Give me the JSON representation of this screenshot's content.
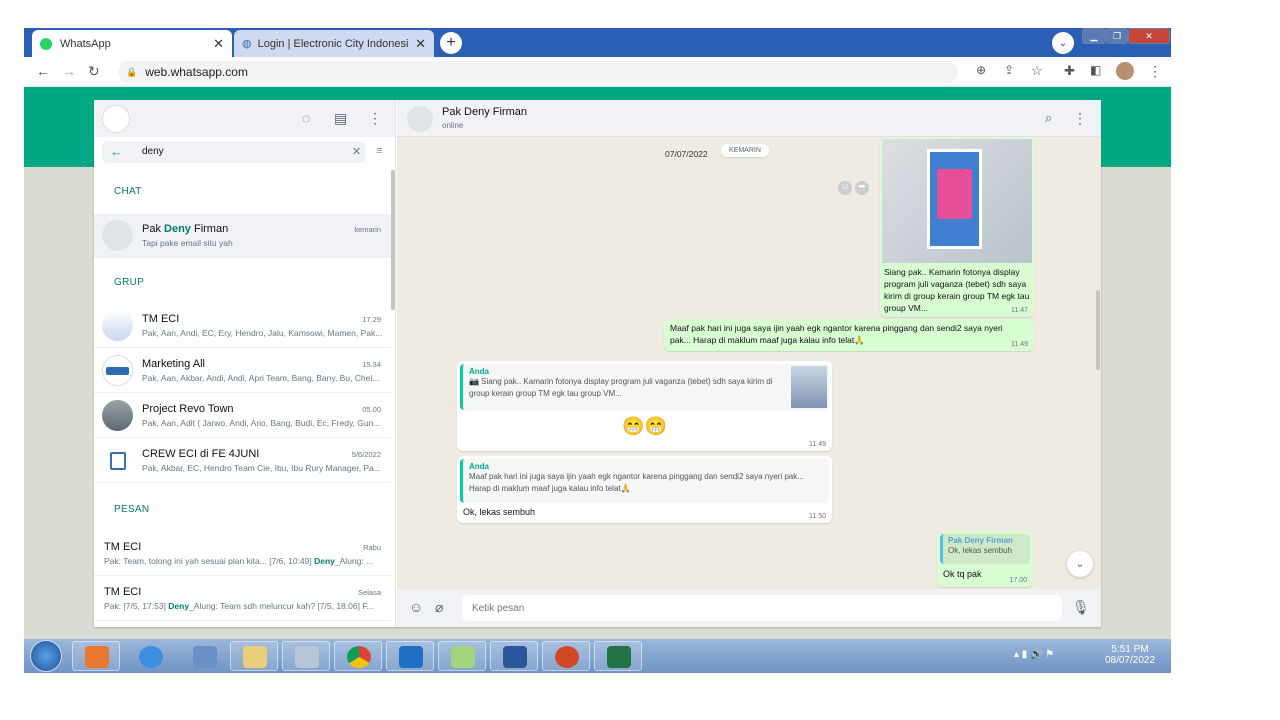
{
  "browser": {
    "tabs": [
      {
        "title": "WhatsApp",
        "active": true
      },
      {
        "title": "Login | Electronic City Indonesia",
        "active": false
      }
    ],
    "url": "web.whatsapp.com"
  },
  "sidebar": {
    "search_value": "deny",
    "sections": {
      "chat": "CHAT",
      "group": "GRUP",
      "messages": "PESAN"
    },
    "chats": [
      {
        "name_pre": "Pak ",
        "name_hl": "Deny",
        "name_post": " Firman",
        "time": "kemarin",
        "message": "Tapi pake email situ yah"
      }
    ],
    "groups": [
      {
        "name": "TM ECI",
        "time": "17.29",
        "message": "Pak, Aan, Andi, EC, Ery, Hendro, Jalu, Kamsowi, Mamen, Pak..."
      },
      {
        "name": "Marketing All",
        "time": "15.34",
        "message": "Pak, Aan, Akbar, Andi, Andi, Apri Team, Bang, Bany, Bu, Chel..."
      },
      {
        "name": "Project Revo Town",
        "time": "05.00",
        "message": "Pak, Aan, Adit ( Jarwo, Andi, Ario, Bang, Budi, Ec, Fredy, Gun..."
      },
      {
        "name": "CREW ECI di FE 4JUNI",
        "time": "5/6/2022",
        "message": "Pak, Akbar, EC, Hendro Team Cie, Ibu, Ibu Rury Manager, Pa..."
      }
    ],
    "messages": [
      {
        "name": "TM ECI",
        "time": "Rabu",
        "pre": "Pak: Team, tolong ini yah sesuai plan kita... [7/6, 10:49] ",
        "hl": "Deny",
        "post": "_Alung: ..."
      },
      {
        "name": "TM ECI",
        "time": "Selasa",
        "pre": "Pak: [7/5, 17:53] ",
        "hl": "Deny",
        "post": "_Alung: Team sdh meluncur kah? [7/5, 18:06] F..."
      }
    ]
  },
  "chat": {
    "contact_name": "Pak Deny Firman",
    "status": "online",
    "date_label": "07/07/2022",
    "day_badge": "KEMARIN",
    "img_caption": "Siang pak.. Kamarin fotonya display program juli vaganza (tebet) sdh saya kirim di group kerain group TM egk tau group VM...",
    "img_time": "11.47",
    "out_msg": "Maaf pak hari ini juga saya ijin yaah egk ngantor karena pinggang dan sendi2 saya nyeri pak... Harap di maklum  maaf juga kalau info telat🙏",
    "out_msg_time": "11.49",
    "reply1": {
      "quote_name": "Anda",
      "quote_text": "📷 Siang pak.. Kamarin fotonya display program juli vaganza (tebet) sdh saya kirim di group kerain group TM egk tau group VM...",
      "text": "😁😁",
      "time": "11.49"
    },
    "reply2": {
      "quote_name": "Anda",
      "quote_text": "Maaf pak hari ini juga saya ijin yaah egk ngantor karena pinggang dan sendi2 saya nyeri pak... Harap di maklum  maaf juga kalau info telat🙏",
      "text": "Ok, lekas sembuh",
      "time": "11.50"
    },
    "reply3": {
      "quote_name": "Pak Deny Firman",
      "quote_text": "Ok, lekas sembuh",
      "text": "Ok tq pak",
      "time": "17.00"
    },
    "input_placeholder": "Ketik pesan"
  },
  "taskbar": {
    "time": "5:51 PM",
    "date": "08/07/2022"
  },
  "colors": {
    "accent": "#00a884",
    "bubble_out": "#d9fdd3",
    "chat_bg": "#efeae2"
  }
}
